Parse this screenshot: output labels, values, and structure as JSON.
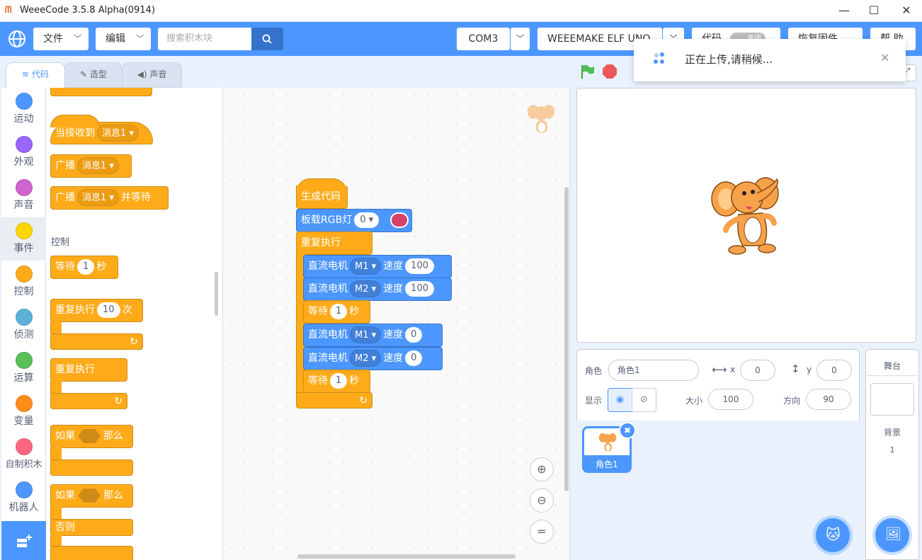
{
  "window": {
    "title": "WeeeCode 3.5.8 Alpha(0914)",
    "minimize": "—",
    "maximize": "☐",
    "close": "✕"
  },
  "menu": {
    "file": "文件",
    "edit": "编辑",
    "search_placeholder": "搜索积木块",
    "port": "COM3",
    "board": "WEEEMAKE ELF UNO",
    "code_toggle": "代码",
    "toggle_state": "关闭",
    "restore": "恢复固件",
    "help": "帮 助"
  },
  "tabs": [
    {
      "label": "代码"
    },
    {
      "label": "造型"
    },
    {
      "label": "声音"
    }
  ],
  "categories": [
    {
      "label": "运动",
      "color": "#4c97ff"
    },
    {
      "label": "外观",
      "color": "#9966ff"
    },
    {
      "label": "声音",
      "color": "#cf63cf"
    },
    {
      "label": "事件",
      "color": "#ffd500"
    },
    {
      "label": "控制",
      "color": "#ffab19"
    },
    {
      "label": "侦测",
      "color": "#5cb1d6"
    },
    {
      "label": "运算",
      "color": "#59c059"
    },
    {
      "label": "变量",
      "color": "#ff8c1a"
    },
    {
      "label": "自制积木",
      "color": "#ff6680"
    },
    {
      "label": "机器人",
      "color": "#4c97ff"
    }
  ],
  "palette": {
    "when_receive": "当接收到",
    "msg1": "消息1",
    "broadcast": "广播",
    "broadcast_wait_suffix": "并等待",
    "section_control": "控制",
    "wait": "等待",
    "wait_val": "1",
    "sec": "秒",
    "repeat": "重复执行",
    "repeat_val": "10",
    "times": "次",
    "forever": "重复执行",
    "if": "如果",
    "then": "那么",
    "else": "否则"
  },
  "script": {
    "hat": "生成代码",
    "rgb_label": "板载RGB灯",
    "rgb_val": "0",
    "rgb_color": "#d6426b",
    "forever": "重复执行",
    "motor": "直流电机",
    "speed": "速度",
    "m1": "M1",
    "m2": "M2",
    "v100": "100",
    "v0": "0",
    "wait": "等待",
    "wait_val": "1",
    "sec": "秒"
  },
  "toast": {
    "message": "正在上传,请稍候..."
  },
  "sprite": {
    "label_sprite": "角色",
    "name": "角色1",
    "x_label": "x",
    "x": "0",
    "y_label": "y",
    "y": "0",
    "show_label": "显示",
    "size_label": "大小",
    "size": "100",
    "dir_label": "方向",
    "direction": "90",
    "thumb_label": "角色1"
  },
  "stage_pane": {
    "title": "舞台",
    "backdrop_label": "背景",
    "backdrop_count": "1"
  }
}
